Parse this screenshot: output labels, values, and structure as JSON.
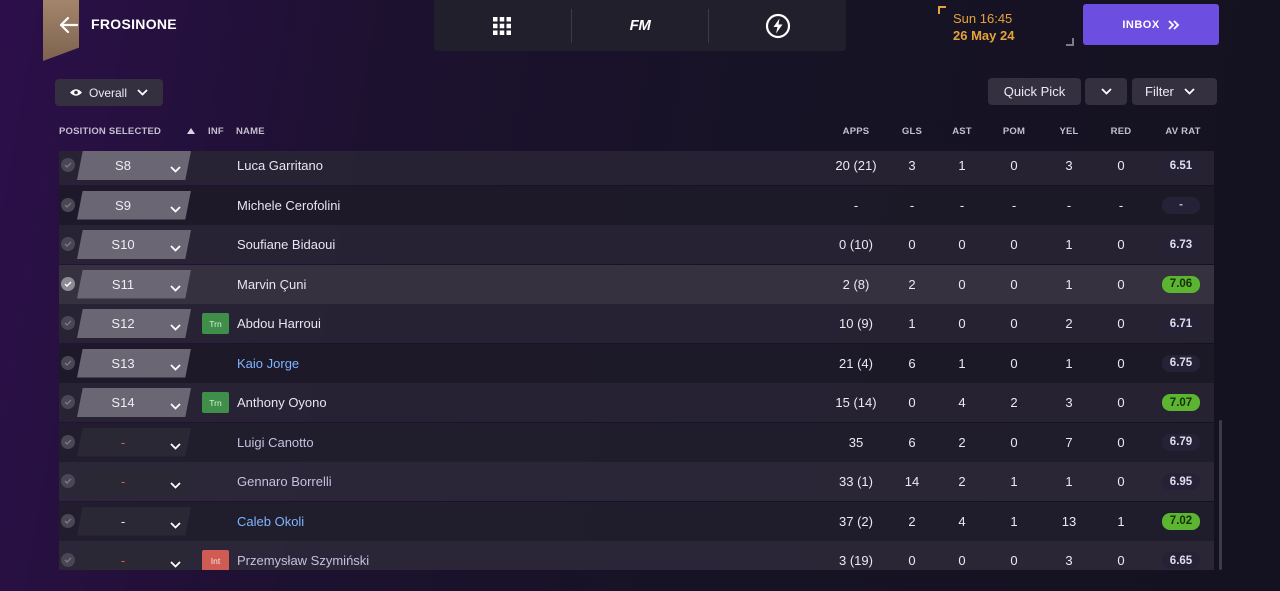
{
  "header": {
    "club_title": "FROSINONE",
    "date_time": "Sun 16:45",
    "date_day": "26 May 24",
    "inbox_label": "INBOX",
    "nav_fm_label": "FM"
  },
  "toolbar": {
    "view_label": "Overall",
    "quick_pick_label": "Quick Pick",
    "filter_label": "Filter"
  },
  "columns": {
    "position": "POSITION SELECTED",
    "inf": "INF",
    "name": "NAME",
    "apps": "APPS",
    "gls": "GLS",
    "ast": "AST",
    "pom": "POM",
    "yel": "YEL",
    "red": "RED",
    "av_rat": "AV RAT"
  },
  "colors": {
    "accent": "#6c4ee0",
    "date": "#e5a33b",
    "good_rating": "#5cb531",
    "link_name": "#7fb4ff"
  },
  "rows": [
    {
      "pos": "S8",
      "inf": "",
      "name": "Luca Garritano",
      "apps": "20 (21)",
      "gls": "3",
      "ast": "1",
      "pom": "0",
      "yel": "3",
      "red": "0",
      "rat": "6.51"
    },
    {
      "pos": "S9",
      "inf": "",
      "name": "Michele Cerofolini",
      "apps": "-",
      "gls": "-",
      "ast": "-",
      "pom": "-",
      "yel": "-",
      "red": "-",
      "rat": "-"
    },
    {
      "pos": "S10",
      "inf": "",
      "name": "Soufiane Bidaoui",
      "apps": "0 (10)",
      "gls": "0",
      "ast": "0",
      "pom": "0",
      "yel": "1",
      "red": "0",
      "rat": "6.73"
    },
    {
      "pos": "S11",
      "inf": "",
      "name": "Marvin Çuni",
      "apps": "2 (8)",
      "gls": "2",
      "ast": "0",
      "pom": "0",
      "yel": "1",
      "red": "0",
      "rat": "7.06"
    },
    {
      "pos": "S12",
      "inf": "Trn",
      "name": "Abdou Harroui",
      "apps": "10 (9)",
      "gls": "1",
      "ast": "0",
      "pom": "0",
      "yel": "2",
      "red": "0",
      "rat": "6.71"
    },
    {
      "pos": "S13",
      "inf": "",
      "name": "Kaio Jorge",
      "apps": "21 (4)",
      "gls": "6",
      "ast": "1",
      "pom": "0",
      "yel": "1",
      "red": "0",
      "rat": "6.75"
    },
    {
      "pos": "S14",
      "inf": "Trn",
      "name": "Anthony Oyono",
      "apps": "15 (14)",
      "gls": "0",
      "ast": "4",
      "pom": "2",
      "yel": "3",
      "red": "0",
      "rat": "7.07"
    },
    {
      "pos": "-",
      "inf": "",
      "name": "Luigi Canotto",
      "apps": "35",
      "gls": "6",
      "ast": "2",
      "pom": "0",
      "yel": "7",
      "red": "0",
      "rat": "6.79"
    },
    {
      "pos": "-",
      "inf": "",
      "name": "Gennaro Borrelli",
      "apps": "33 (1)",
      "gls": "14",
      "ast": "2",
      "pom": "1",
      "yel": "1",
      "red": "0",
      "rat": "6.95"
    },
    {
      "pos": "-",
      "inf": "",
      "name": "Caleb Okoli",
      "apps": "37 (2)",
      "gls": "2",
      "ast": "4",
      "pom": "1",
      "yel": "13",
      "red": "1",
      "rat": "7.02"
    },
    {
      "pos": "-",
      "inf": "Int",
      "name": "Przemysław Szymiński",
      "apps": "3 (19)",
      "gls": "0",
      "ast": "0",
      "pom": "0",
      "yel": "3",
      "red": "0",
      "rat": "6.65"
    }
  ]
}
